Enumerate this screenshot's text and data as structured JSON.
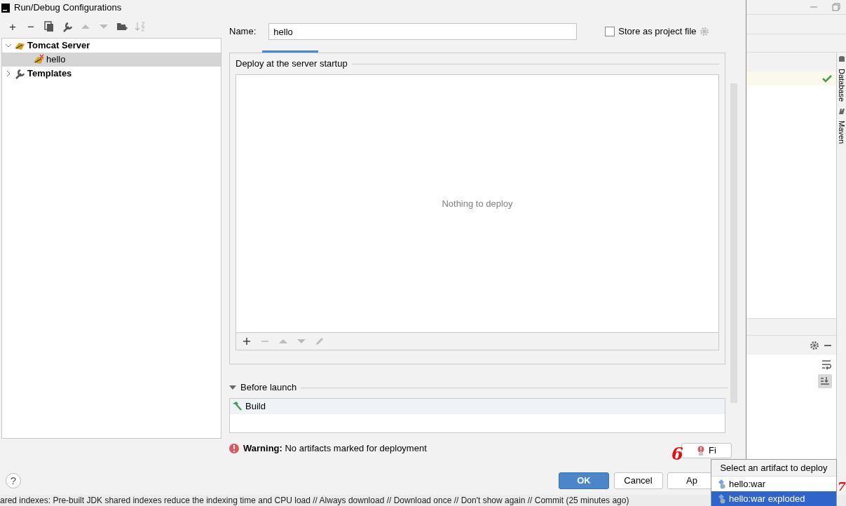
{
  "dialog": {
    "title": "Run/Debug Configurations"
  },
  "toolbar": [
    "+",
    "−"
  ],
  "tree": [
    {
      "label": "Tomcat Server",
      "expanded": true,
      "selected": false,
      "children": [
        {
          "label": "hello",
          "selected": true
        }
      ]
    },
    {
      "label": "Templates",
      "expanded": false,
      "selected": false
    }
  ],
  "name_field": {
    "label": "Name:",
    "value": "hello"
  },
  "store_as_project_file": {
    "label": "Store as project file",
    "checked": false
  },
  "deploy": {
    "title": "Deploy at the server startup",
    "empty_text": "Nothing to deploy"
  },
  "before_launch": {
    "title": "Before launch",
    "expanded": true,
    "items": [
      "Build"
    ]
  },
  "warning": {
    "title": "Warning:",
    "text": "No artifacts marked for deployment"
  },
  "buttons": [
    {
      "label": "Fi",
      "kind": "fix"
    },
    {
      "label": "OK",
      "kind": "primary"
    },
    {
      "label": "Cancel",
      "kind": "default"
    },
    {
      "label": "Ap",
      "kind": "default"
    }
  ],
  "popup": {
    "title": "Select an artifact to deploy",
    "items": [
      {
        "label": "hello:war",
        "selected": false
      },
      {
        "label": "hello:war exploded",
        "selected": true
      }
    ]
  },
  "help": "?",
  "annotations": [
    "6",
    "7"
  ],
  "ide": {
    "side_tabs": [
      "Database",
      "Maven"
    ],
    "status_text": "ared indexes: Pre-built JDK shared indexes reduce the indexing time and CPU load // Always download // Download once // Don't show again // Commit (25 minutes ago)"
  }
}
